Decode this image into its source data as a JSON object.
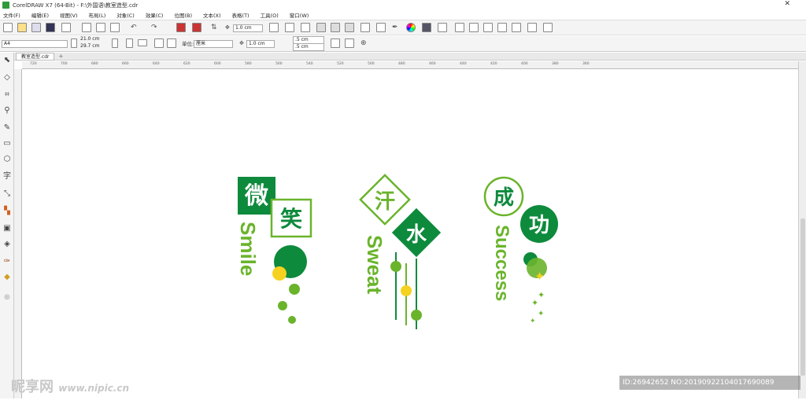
{
  "window": {
    "title": "CorelDRAW X7 (64-Bit) - F:\\外国语\\教室造型.cdr",
    "close_glyph": "✕"
  },
  "menu": [
    "文件(F)",
    "编辑(E)",
    "视图(V)",
    "布局(L)",
    "对象(C)",
    "效果(C)",
    "位图(B)",
    "文本(X)",
    "表格(T)",
    "工具(O)",
    "窗口(W)"
  ],
  "toolbar": {
    "nudge_value": "1.0 cm"
  },
  "property_bar": {
    "page_size": "A4",
    "width": "21.0 cm",
    "height": "29.7 cm",
    "unit_label": "单位:",
    "unit_value": "厘米",
    "nudge": "1.0 cm",
    "dup_x": ".5 cm",
    "dup_y": ".5 cm"
  },
  "tabs": {
    "active": "教室造型.cdr",
    "add_glyph": "+"
  },
  "ruler_h_ticks": [
    "720",
    "700",
    "680",
    "660",
    "640",
    "620",
    "600",
    "580",
    "560",
    "540",
    "520",
    "500",
    "480",
    "460",
    "440",
    "420",
    "400",
    "380",
    "360"
  ],
  "toolbox_icons": [
    "pick-tool",
    "shape-tool",
    "crop-tool",
    "zoom-tool",
    "freehand-tool",
    "rectangle-tool",
    "polygon-tool",
    "text-tool",
    "dimension-tool",
    "connector-tool",
    "drop-shadow-tool",
    "transparency-tool",
    "eyedropper-tool",
    "fill-tool",
    "add-tool"
  ],
  "design": {
    "smile": {
      "char1": "微",
      "char2": "笑",
      "word": "Smile"
    },
    "sweat": {
      "char1": "汗",
      "char2": "水",
      "word": "Sweat"
    },
    "success": {
      "char1": "成",
      "char2": "功",
      "word": "Success"
    },
    "colors": {
      "dark_green": "#0e8a3c",
      "light_green": "#6ab42c",
      "yellow": "#f5d21f"
    }
  },
  "watermark": {
    "site": "昵享网",
    "url": "www.nipic.cn",
    "id_text": "ID:26942652 NO:20190922104017690089"
  }
}
